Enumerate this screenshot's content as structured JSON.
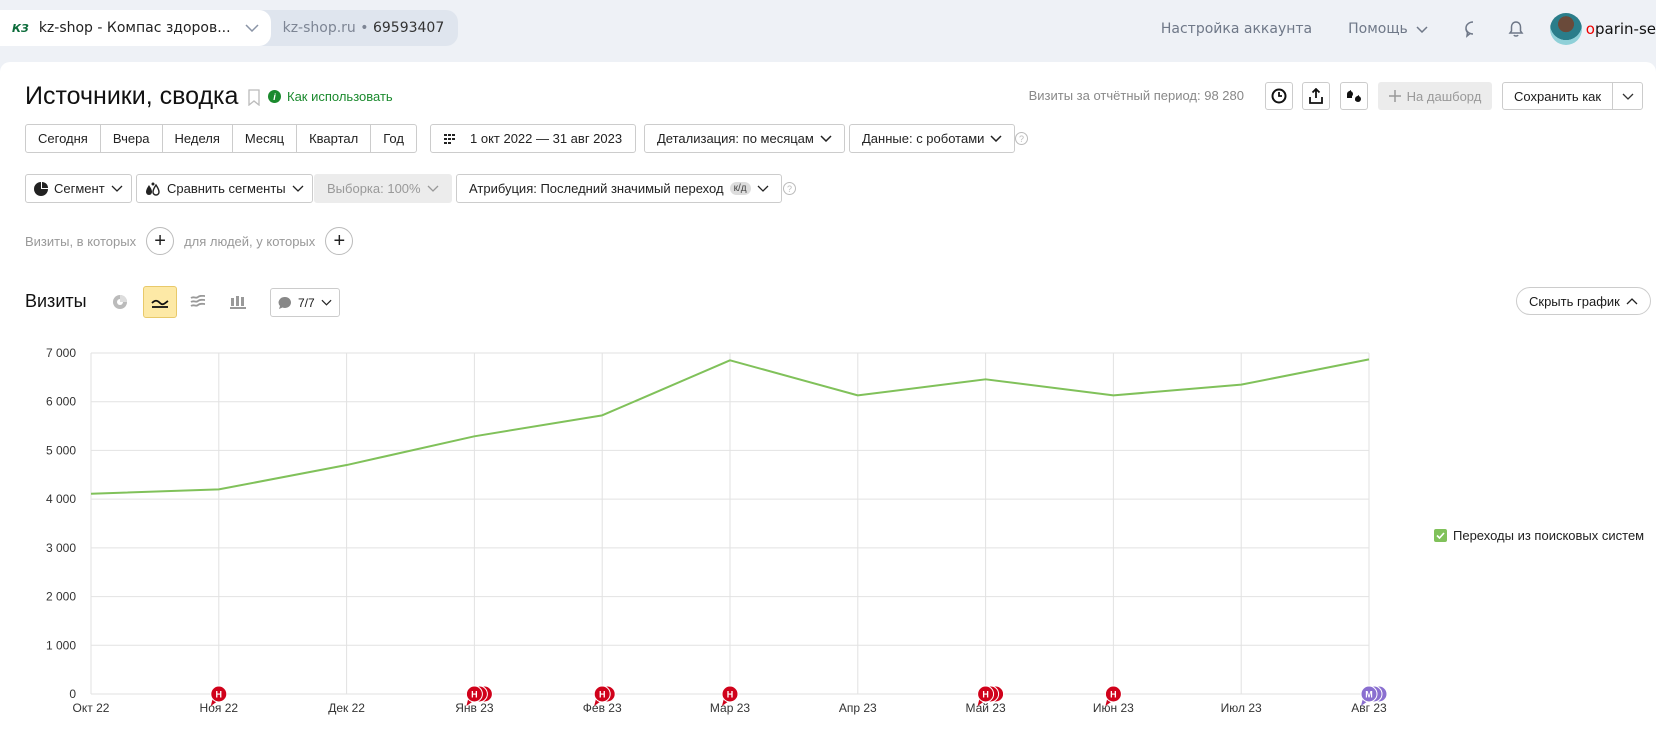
{
  "topbar": {
    "counter_logo": "КЗ",
    "counter_name": "kz-shop - Компас здоров...",
    "counter_domain": "kz-shop.ru",
    "counter_id": "69593407",
    "nav_account": "Настройка аккаунта",
    "nav_help": "Помощь",
    "username_first": "o",
    "username_rest": "parin-se"
  },
  "report": {
    "title": "Источники, сводка",
    "how_to_use": "Как использовать",
    "visits_total": "Визиты за отчётный период: 98 280",
    "add_dashboard": "На дашборд",
    "save_as": "Сохранить как"
  },
  "periods": [
    "Сегодня",
    "Вчера",
    "Неделя",
    "Месяц",
    "Квартал",
    "Год"
  ],
  "date_range": "1 окт 2022 — 31 авг 2023",
  "detail": "Детализация: по месяцам",
  "data_mode": "Данные: с роботами",
  "segment": "Сегмент",
  "compare": "Сравнить сегменты",
  "sampling": "Выборка: 100%",
  "attribution": "Атрибуция: Последний значимый переход",
  "attribution_badge": "к/д",
  "filters": {
    "visits_where": "Визиты, в которых",
    "people_where": "для людей, у которых"
  },
  "chart_section": {
    "title": "Визиты",
    "notes_count": "7/7",
    "hide_chart": "Скрыть график"
  },
  "colors": {
    "line": "#80c15a",
    "note_red": "#d0021b",
    "note_purple": "#8a6fd0",
    "link_green": "#1b8a2e"
  },
  "chart_data": {
    "type": "line",
    "title": "Визиты",
    "xlabel": "",
    "ylabel": "",
    "categories": [
      "Окт 22",
      "Ноя 22",
      "Дек 22",
      "Янв 23",
      "Фев 23",
      "Мар 23",
      "Апр 23",
      "Май 23",
      "Июн 23",
      "Июл 23",
      "Авг 23"
    ],
    "series": [
      {
        "name": "Переходы из поисковых систем",
        "values": [
          4110,
          4200,
          4700,
          5290,
          5720,
          6850,
          6130,
          6460,
          6130,
          6350,
          6870
        ]
      }
    ],
    "ylim": [
      0,
      7000
    ],
    "yticks": [
      0,
      1000,
      2000,
      3000,
      4000,
      5000,
      6000,
      7000
    ],
    "ytick_labels": [
      "0",
      "1 000",
      "2 000",
      "3 000",
      "4 000",
      "5 000",
      "6 000",
      "7 000"
    ],
    "grid": true,
    "legend": "right",
    "annotations": [
      {
        "category": "Ноя 22",
        "letter": "Н",
        "count": 1,
        "color": "red"
      },
      {
        "category": "Янв 23",
        "letter": "Н",
        "count": 3,
        "color": "red"
      },
      {
        "category": "Фев 23",
        "letter": "Н",
        "count": 2,
        "color": "red"
      },
      {
        "category": "Мар 23",
        "letter": "Н",
        "count": 1,
        "color": "red"
      },
      {
        "category": "Май 23",
        "letter": "Н",
        "count": 3,
        "color": "red"
      },
      {
        "category": "Июн 23",
        "letter": "Н",
        "count": 1,
        "color": "red"
      },
      {
        "category": "Авг 23",
        "letter": "М",
        "count": 3,
        "color": "purple"
      }
    ]
  }
}
